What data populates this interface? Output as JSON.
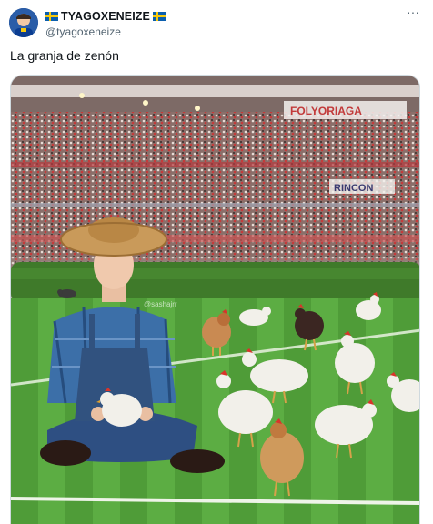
{
  "tweet": {
    "author": {
      "display_name": "TYAGOXENEIZE",
      "handle": "@tyagoxeneize",
      "flag_icon": "sweden-flag-icon"
    },
    "more_icon": "more-horizontal-icon",
    "more_label": "···",
    "text": "La granja de zenón",
    "media": {
      "watermark": "@sashajrr",
      "stadium_banners": [
        "FOLYORIAGA",
        "RINCON"
      ]
    }
  },
  "colors": {
    "text_primary": "#0f1419",
    "text_secondary": "#536471",
    "border": "#cfd9de",
    "flag_blue": "#0b5fae",
    "flag_yellow": "#f6c90e"
  }
}
